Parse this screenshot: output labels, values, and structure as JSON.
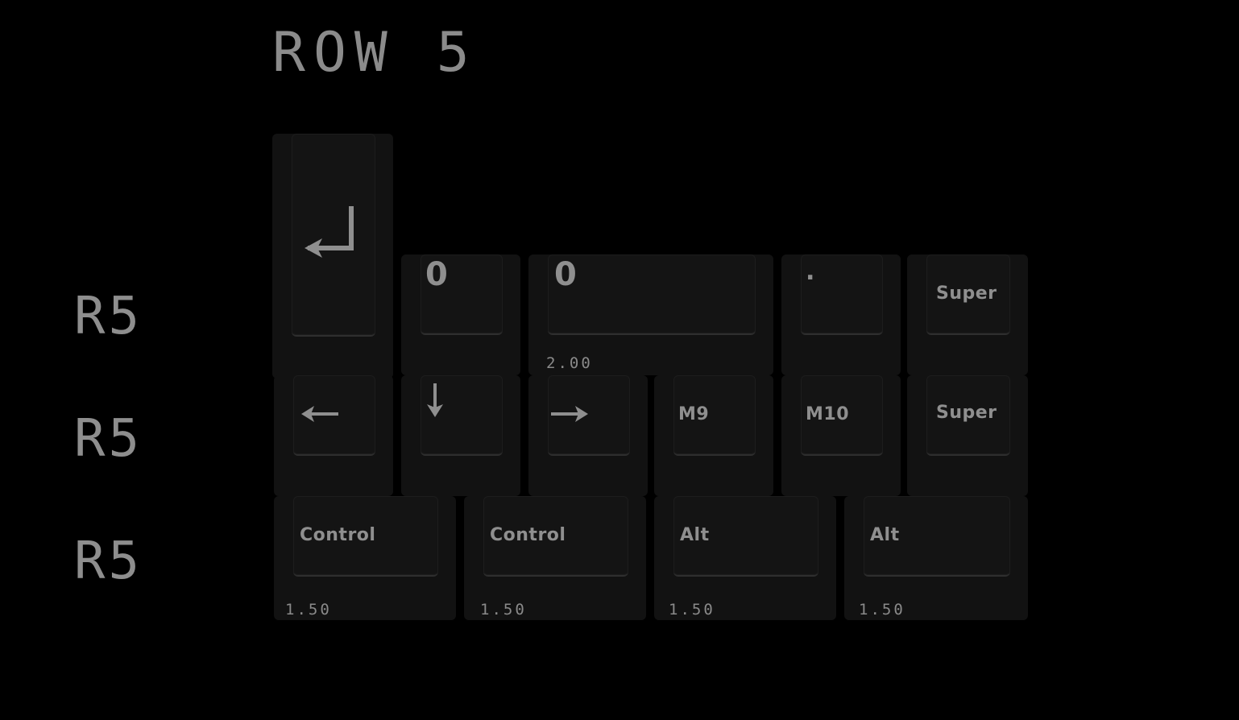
{
  "title": "ROW 5",
  "row_labels": [
    "R5",
    "R5",
    "R5"
  ],
  "keys": {
    "enter": {
      "icon": "enter-arrow-icon"
    },
    "zero_small": {
      "legend": "0"
    },
    "zero_wide": {
      "legend": "0",
      "size": "2.00"
    },
    "dot": {
      "legend": "."
    },
    "super_1": {
      "legend": "Super"
    },
    "left": {
      "icon": "left-arrow-icon"
    },
    "down": {
      "icon": "down-arrow-icon"
    },
    "right": {
      "icon": "right-arrow-icon"
    },
    "m9": {
      "legend": "M9"
    },
    "m10": {
      "legend": "M10"
    },
    "super_2": {
      "legend": "Super"
    },
    "control_1": {
      "legend": "Control",
      "size": "1.50"
    },
    "control_2": {
      "legend": "Control",
      "size": "1.50"
    },
    "alt_1": {
      "legend": "Alt",
      "size": "1.50"
    },
    "alt_2": {
      "legend": "Alt",
      "size": "1.50"
    }
  },
  "colors": {
    "background": "#000000",
    "keycap": "#141414",
    "legend": "#8f8f8f"
  }
}
